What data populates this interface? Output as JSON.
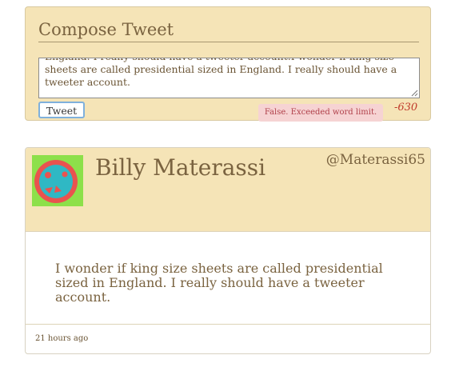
{
  "compose": {
    "title": "Compose Tweet",
    "textarea_value": "England. I really should have a tweeter account.I wonder if king size sheets are called presidential sized in England. I really should have a tweeter account.",
    "tweet_button_label": "Tweet",
    "error_message": "False. Exceeded word limit.",
    "char_count": "-630"
  },
  "tweet": {
    "author_name": "Billy Materassi",
    "handle": "@Materassi65",
    "body": "I wonder if king size sheets are called presidential sized in England. I really should have a tweeter account.",
    "timestamp": "21 hours ago",
    "avatar_icon": "identicon-avatar-icon"
  },
  "colors": {
    "panel_bg": "#f5e4b7",
    "text": "#7a6340",
    "error_text": "#b0404a",
    "error_bg": "#f6d3d3",
    "count_text": "#c0392b",
    "avatar_bg": "#8de04a",
    "avatar_circle": "#e9534f",
    "avatar_inner": "#2fb8c4"
  }
}
